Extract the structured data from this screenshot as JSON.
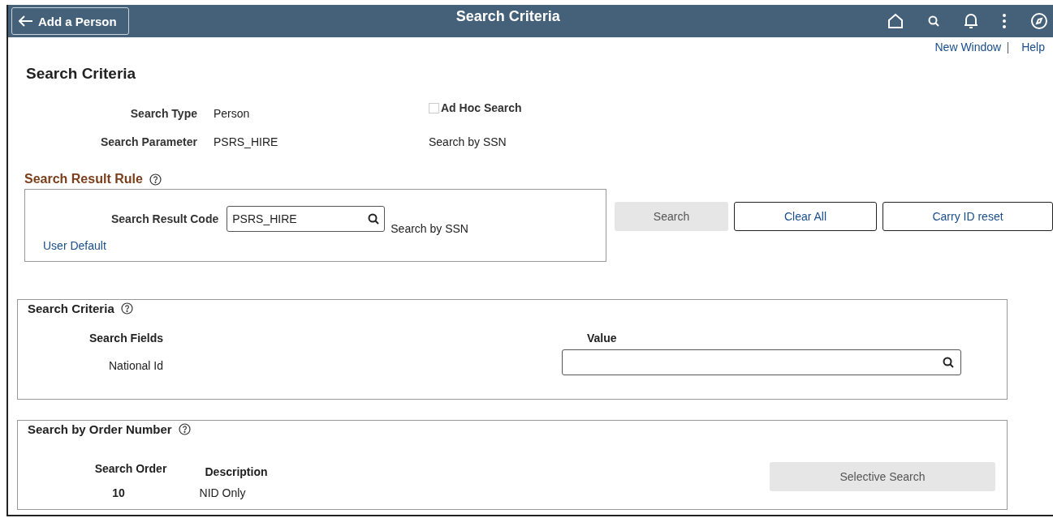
{
  "header": {
    "back_button": "Add a Person",
    "title": "Search Criteria"
  },
  "top_links": [
    "New Window",
    "Help"
  ],
  "page_title": "Search Criteria",
  "info": {
    "search_type_label": "Search Type",
    "search_type": "Person",
    "ad_hoc": {
      "label": "Ad Hoc Search",
      "checked": false,
      "disabled": true
    },
    "search_parameter_label": "Search Parameter",
    "search_parameter": "PSRS_HIRE",
    "search_parameter_description": "Search by SSN"
  },
  "result_rule": {
    "title": "Search Result Rule",
    "code_label": "Search Result Code",
    "code_value": "PSRS_HIRE",
    "code_description": "Search by SSN",
    "link": "User Default"
  },
  "buttons": [
    {
      "label": "Search",
      "disabled": true
    },
    {
      "label": "Clear All",
      "disabled": false
    },
    {
      "label": "Carry ID reset",
      "disabled": false
    }
  ],
  "criteria": {
    "title": "Search Criteria",
    "columns": [
      "Search Fields",
      "Value"
    ],
    "rows": [
      {
        "field": "National Id",
        "value": ""
      }
    ]
  },
  "order": {
    "title": "Search by Order Number",
    "columns": [
      "Search Order",
      "Description"
    ],
    "rows": [
      {
        "order": "10",
        "description": "NID Only"
      }
    ],
    "button": {
      "label": "Selective Search",
      "disabled": true
    }
  }
}
